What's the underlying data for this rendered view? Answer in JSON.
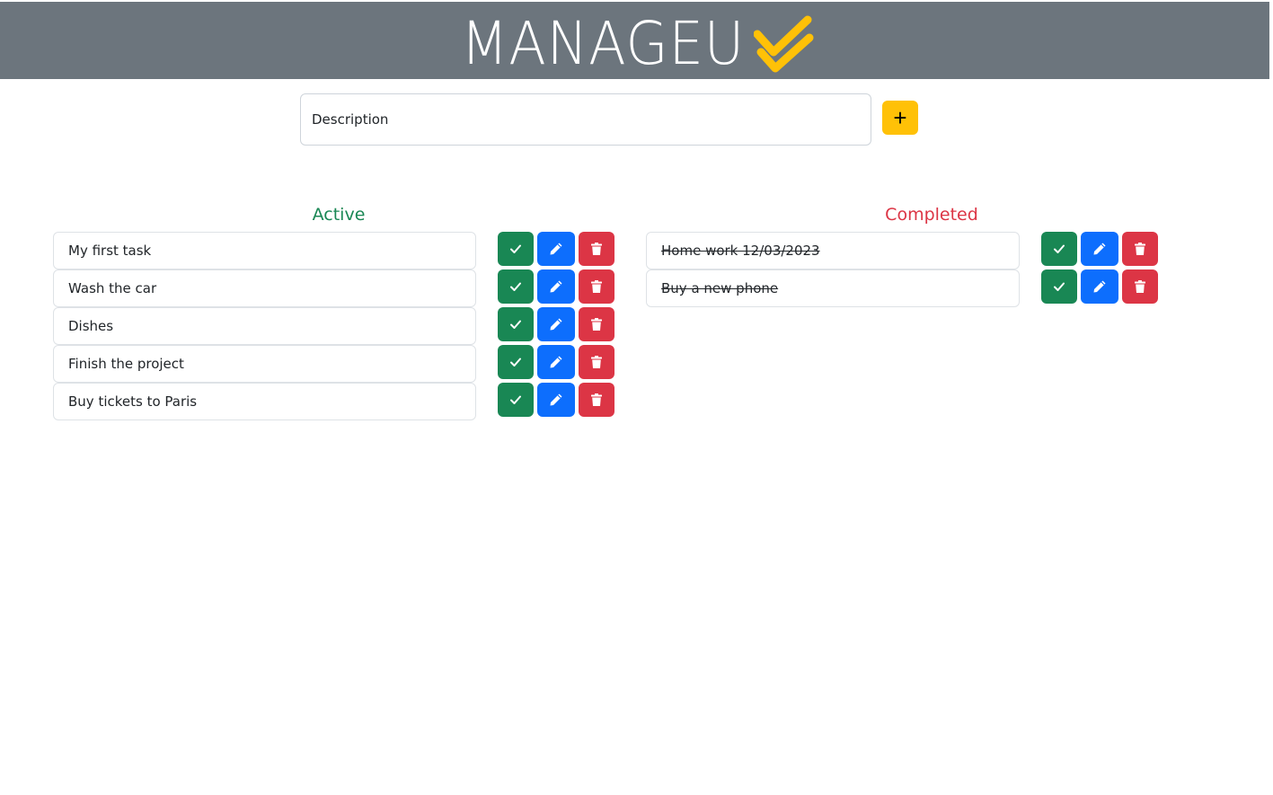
{
  "header": {
    "logo_text": "MANAGEU",
    "logo_check_color": "#ffc107",
    "background": "#6c757d"
  },
  "new_task": {
    "placeholder": "Description",
    "value": "",
    "add_label": "+"
  },
  "columns": {
    "active": {
      "title": "Active",
      "color": "#198754",
      "tasks": [
        "My first task",
        "Wash the car",
        "Dishes",
        "Finish the project",
        "Buy tickets to Paris"
      ]
    },
    "completed": {
      "title": "Completed",
      "color": "#dc3545",
      "tasks": [
        "Home work 12/03/2023",
        "Buy a new phone"
      ]
    }
  },
  "actions": {
    "complete_icon": "check-icon",
    "edit_icon": "pencil-icon",
    "delete_icon": "trash-icon",
    "complete_color": "#198754",
    "edit_color": "#0d6efd",
    "delete_color": "#dc3545"
  }
}
